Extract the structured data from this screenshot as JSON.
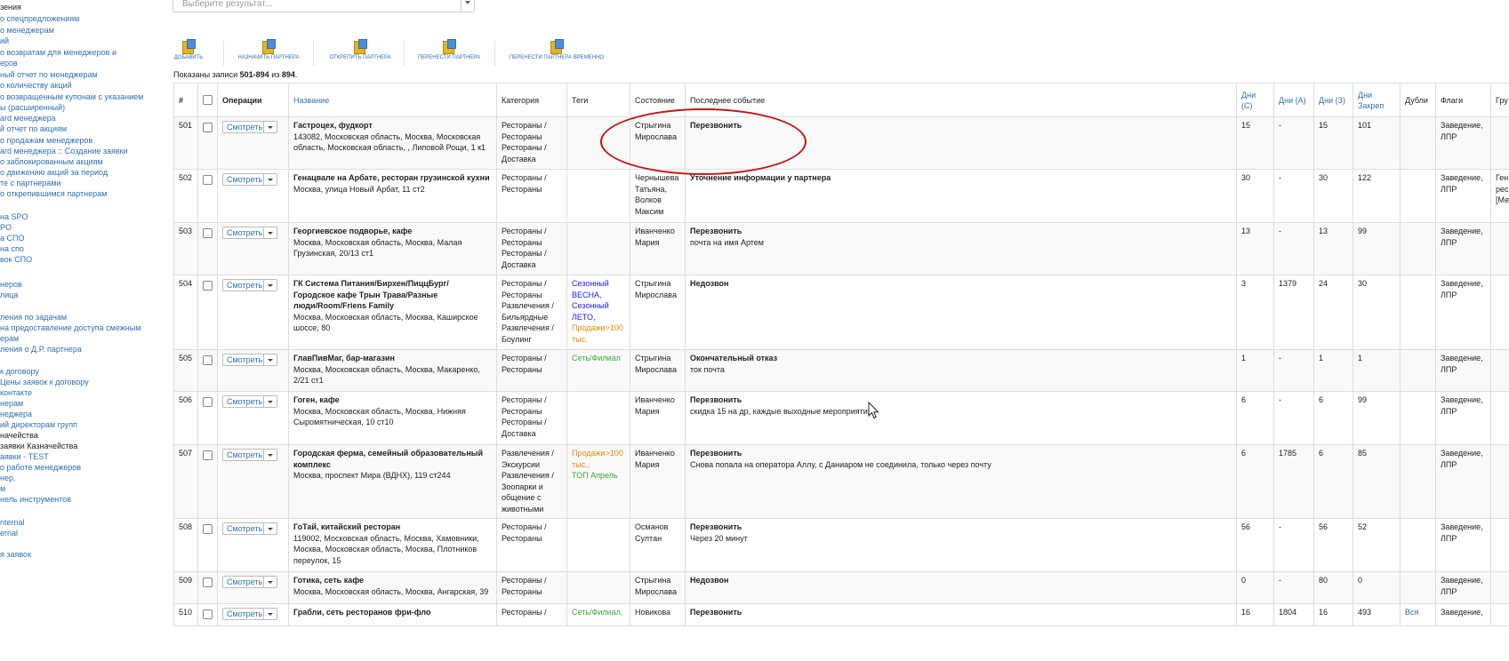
{
  "sidebar": {
    "items": [
      {
        "label": "зения",
        "dark": true
      },
      {
        "label": "о спецпредложениям"
      },
      {
        "label": "о менеджерам"
      },
      {
        "label": "ий"
      },
      {
        "label": "о возвратам для менеджеров и"
      },
      {
        "label": "еров"
      },
      {
        "label": "ный отчет по менеджерам"
      },
      {
        "label": "о количеству акций"
      },
      {
        "label": "о возвращенным купонам с указанием"
      },
      {
        "label": "ы (расширенный)"
      },
      {
        "label": "ard менеджера"
      },
      {
        "label": "й отчет по акциям"
      },
      {
        "label": "о продажам менеджеров"
      },
      {
        "label": "ard менеджера :: Создание заявки"
      },
      {
        "label": "о заблокированным акциям"
      },
      {
        "label": "о движению акций за период"
      },
      {
        "label": "те с партнерами"
      },
      {
        "label": "о открепившимся партнерам"
      },
      {
        "label": "на SPO"
      },
      {
        "label": "PO"
      },
      {
        "label": "а СПО"
      },
      {
        "label": "на спо"
      },
      {
        "label": "вок СПО"
      },
      {
        "label": "неров"
      },
      {
        "label": "лица"
      },
      {
        "label": "ления по задачам"
      },
      {
        "label": "на предоставление доступа смежным"
      },
      {
        "label": "ерам"
      },
      {
        "label": "ления о Д.Р. партнера"
      },
      {
        "label": "к договору"
      },
      {
        "label": "Цены заявок к договору"
      },
      {
        "label": "контакте"
      },
      {
        "label": "нерам"
      },
      {
        "label": "неджера"
      },
      {
        "label": "ий директорам групп"
      },
      {
        "label": "начейства",
        "dark": true
      },
      {
        "label": "заявки Казначейства",
        "dark": true
      },
      {
        "label": "аявки - TEST"
      },
      {
        "label": "о работе менеджеров"
      },
      {
        "label": "нер."
      },
      {
        "label": "м"
      },
      {
        "label": "нель инструментов"
      },
      {
        "label": "nternal"
      },
      {
        "label": "ernal"
      },
      {
        "label": "я заявок"
      }
    ]
  },
  "result_select": {
    "placeholder": "Выберите результат..."
  },
  "toolbar": {
    "buttons": [
      {
        "label": "ДОБАВИТЬ"
      },
      {
        "label": "НАЗНАЧИТЬ ПАРТНЕРА"
      },
      {
        "label": "ОТКРЕПИТЬ ПАРТНЕРА"
      },
      {
        "label": "ПЕРЕНЕСТИ ПАРТНЕРА"
      },
      {
        "label": "ПЕРЕНЕСТИ ПАРТНЕРА ВРЕМЕННО"
      }
    ]
  },
  "records": {
    "prefix": "Показаны записи ",
    "range": "501-894",
    "mid": " из ",
    "total": "894",
    "suffix": "."
  },
  "table": {
    "headers": {
      "num": "#",
      "ops": "Операции",
      "name": "Название",
      "category": "Категория",
      "tags": "Теги",
      "state": "Состояние",
      "last_event": "Последнее событие",
      "days_c": "Дни (С)",
      "days_a": "Дни (А)",
      "days_z": "Дни (З)",
      "days_pin": "Дни Закреп",
      "dups": "Дубли",
      "flags": "Флаги",
      "group": "Гру"
    },
    "view_label": "Смотреть",
    "rows": [
      {
        "num": "501",
        "name": "Гастроцех, фудкорт",
        "addr": "143082, Московская область, Москва, Московская область, Московская область, , Липовой Рощи, 1 к1",
        "cat": "Рестораны / Рестораны Рестораны / Доставка",
        "tags": [],
        "state": "Стрыгина Мирослава",
        "event": "Перезвонить",
        "note": "",
        "dc": "15",
        "da": "-",
        "dz": "15",
        "dp": "101",
        "dups": "",
        "flags": "Заведение, ЛПР",
        "group": ""
      },
      {
        "num": "502",
        "name": "Генацвале на Арбате, ресторан грузинской кухни",
        "addr": "Москва, улица Новый Арбат, 11 ст2",
        "cat": "Рестораны / Рестораны",
        "tags": [],
        "state": "Чернышева Татьяна, Волков Максим",
        "event": "Уточнение информации у партнера",
        "note": "",
        "dc": "30",
        "da": "-",
        "dz": "30",
        "dp": "122",
        "dups": "",
        "flags": "Заведение, ЛПР",
        "group": "Ген рес [Ме"
      },
      {
        "num": "503",
        "name": "Георгиевское подворье, кафе",
        "addr": "Москва, Московская область, Москва, Малая Грузинская, 20/13 ст1",
        "cat": "Рестораны / Рестораны Рестораны / Доставка",
        "tags": [],
        "state": "Иванченко Мария",
        "event": "Перезвонить",
        "note": "почта на имя Артем",
        "dc": "13",
        "da": "-",
        "dz": "13",
        "dp": "99",
        "dups": "",
        "flags": "Заведение, ЛПР",
        "group": ""
      },
      {
        "num": "504",
        "name": "ГК Система Питания/Бирхен/ПиццБург/ Городское кафе Трын Трава/Разные люди/Room/Friens Family",
        "addr": "Москва, Московская область, Москва, Каширское шоссе, 80",
        "cat": "Рестораны / Рестораны Развлечения / Бильярдные Развлечения / Боулинг",
        "tags": [
          {
            "t": "Сезонный ВЕСНА,",
            "c": "blue"
          },
          {
            "t": "Сезонный ЛЕТО,",
            "c": "blue"
          },
          {
            "t": "Продажи>100 тыс.",
            "c": "orange"
          }
        ],
        "state": "Стрыгина Мирослава",
        "event": "Недозвон",
        "note": "",
        "dc": "3",
        "da": "1379",
        "dz": "24",
        "dp": "30",
        "dups": "",
        "flags": "Заведение, ЛПР",
        "group": ""
      },
      {
        "num": "505",
        "name": "ГлавПивМаг, бар-магазин",
        "addr": "Москва, Московская область, Москва, Макаренко, 2/21 ст1",
        "cat": "Рестораны / Рестораны",
        "tags": [
          {
            "t": "Сеть/Филиал",
            "c": "green"
          }
        ],
        "state": "Стрыгина Мирослава",
        "event": "Окончательный отказ",
        "note": "ток почта",
        "dc": "1",
        "da": "-",
        "dz": "1",
        "dp": "1",
        "dups": "",
        "flags": "Заведение, ЛПР",
        "group": ""
      },
      {
        "num": "506",
        "name": "Гоген, кафе",
        "addr": "Москва, Московская область, Москва, Нижняя Сыромятническая, 10 ст10",
        "cat": "Рестораны / Рестораны Рестораны / Доставка",
        "tags": [],
        "state": "Иванченко Мария",
        "event": "Перезвонить",
        "note": "скидка 15 на др, каждые выходные мероприятия",
        "dc": "6",
        "da": "-",
        "dz": "6",
        "dp": "99",
        "dups": "",
        "flags": "Заведение, ЛПР",
        "group": ""
      },
      {
        "num": "507",
        "name": "Городская ферма, семейный образовательный комплекс",
        "addr": "Москва, проспект Мира (ВДНХ), 119 ст244",
        "cat": "Развлечения / Экскурсии Развлечения / Зоопарки и общение с животными",
        "tags": [
          {
            "t": "Продажи>100 тыс.,",
            "c": "orange"
          },
          {
            "t": "ТОП Апрель",
            "c": "green"
          }
        ],
        "state": "Иванченко Мария",
        "event": "Перезвонить",
        "note": "Снова попала на оператора Аллу, с Даниаром не соединила, только через почту",
        "dc": "6",
        "da": "1785",
        "dz": "6",
        "dp": "85",
        "dups": "",
        "flags": "Заведение, ЛПР",
        "group": ""
      },
      {
        "num": "508",
        "name": "ГоТай, китайский ресторан",
        "addr": "119002, Московская область, Москва, Хамовники, Москва, Московская область, Москва, Плотников переулок, 15",
        "cat": "Рестораны / Рестораны",
        "tags": [],
        "state": "Османов Султан",
        "event": "Перезвонить",
        "note": "Через 20 минут",
        "dc": "56",
        "da": "-",
        "dz": "56",
        "dp": "52",
        "dups": "",
        "flags": "Заведение, ЛПР",
        "group": ""
      },
      {
        "num": "509",
        "name": "Готика, сеть кафе",
        "addr": "Москва, Московская область, Москва, Ангарская, 39",
        "cat": "Рестораны / Рестораны",
        "tags": [],
        "state": "Стрыгина Мирослава",
        "event": "Недозвон",
        "note": "",
        "dc": "0",
        "da": "-",
        "dz": "80",
        "dp": "0",
        "dups": "",
        "flags": "Заведение, ЛПР",
        "group": ""
      },
      {
        "num": "510",
        "name": "Грабли, сеть ресторанов фри-фло",
        "addr": "",
        "cat": "Рестораны /",
        "tags": [
          {
            "t": "Сеть/Филиал,",
            "c": "green"
          }
        ],
        "state": "Новикова",
        "event": "Перезвонить",
        "note": "",
        "dc": "16",
        "da": "1804",
        "dz": "16",
        "dp": "493",
        "dups": "Вся",
        "flags": "Заведение,",
        "group": ""
      }
    ]
  },
  "colors": {
    "link": "#2f6fb5",
    "annotation": "#cc1111",
    "tag_blue": "#1a1aff",
    "tag_orange": "#e88a00",
    "tag_green": "#3aa63a"
  }
}
